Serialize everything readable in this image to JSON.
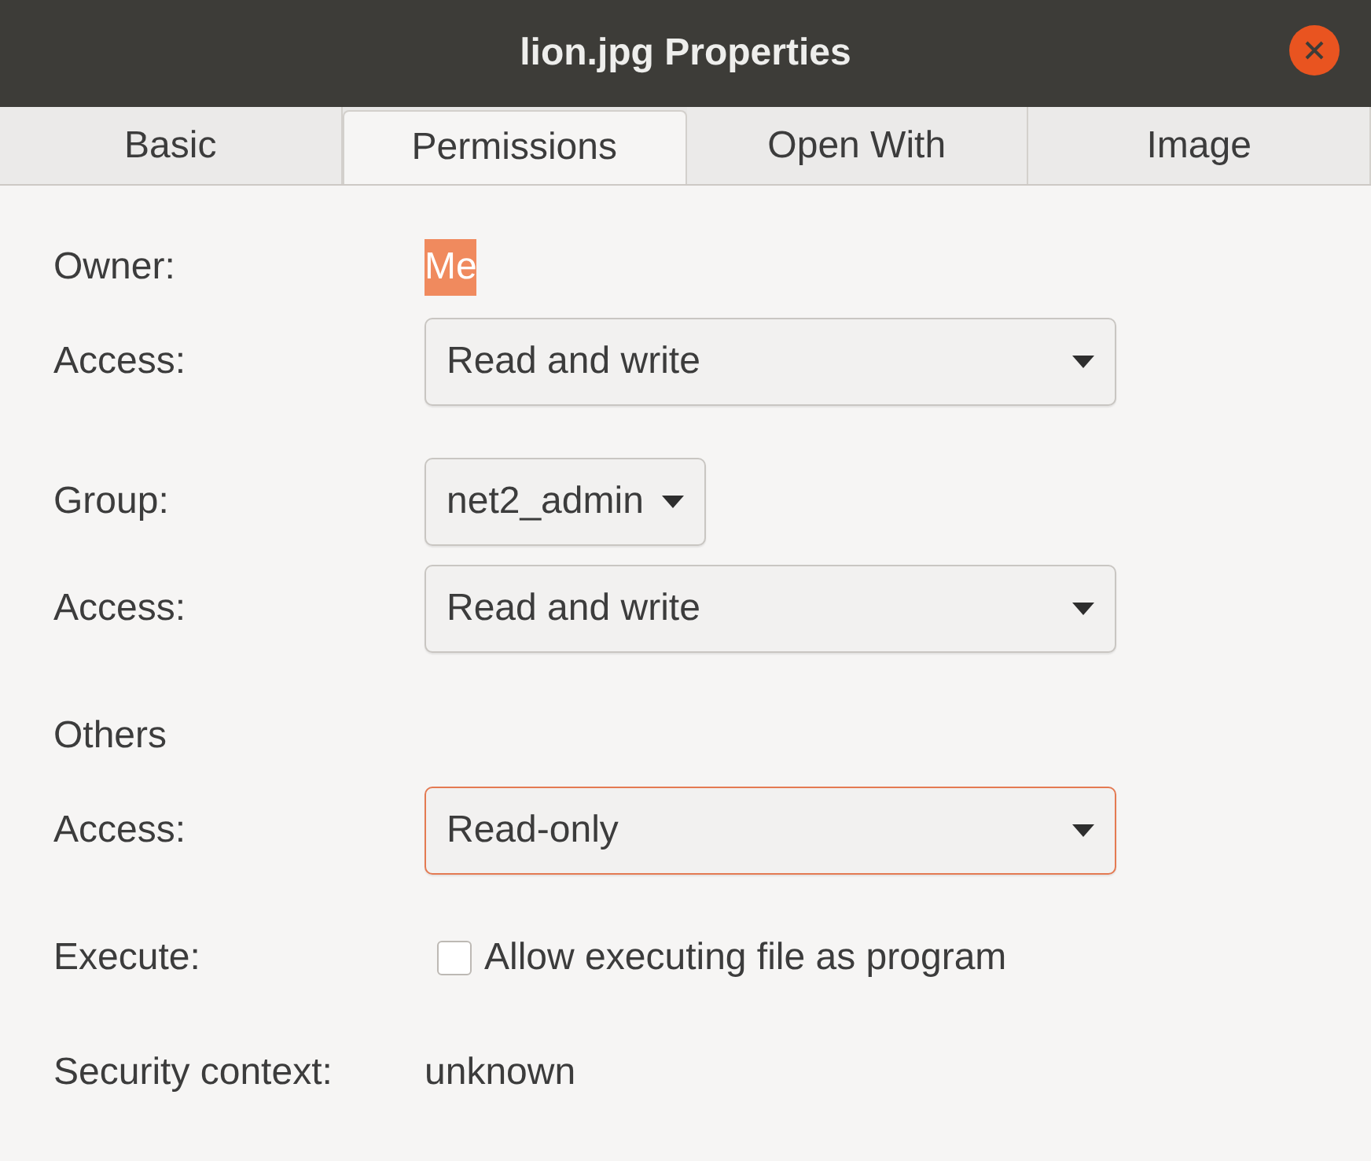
{
  "window": {
    "title": "lion.jpg Properties"
  },
  "tabs": [
    {
      "label": "Basic",
      "selected": false
    },
    {
      "label": "Permissions",
      "selected": true
    },
    {
      "label": "Open With",
      "selected": false
    },
    {
      "label": "Image",
      "selected": false
    }
  ],
  "sections": [
    {
      "rows": [
        {
          "kind": "value",
          "label": "Owner:",
          "value": "Me",
          "highlighted": true
        },
        {
          "kind": "dropdown",
          "label": "Access:",
          "value": "Read and write",
          "focused": false
        }
      ]
    },
    {
      "rows": [
        {
          "kind": "compact_dropdown",
          "label": "Group:",
          "value": "net2_admin",
          "focused": false
        },
        {
          "kind": "dropdown",
          "label": "Access:",
          "value": "Read and write",
          "focused": false
        }
      ]
    },
    {
      "rows": [
        {
          "kind": "heading",
          "label": "Others"
        },
        {
          "kind": "dropdown",
          "label": "Access:",
          "value": "Read-only",
          "focused": true
        }
      ]
    },
    {
      "rows": [
        {
          "kind": "checkbox",
          "label": "Execute:",
          "text": "Allow executing file as program",
          "checked": false
        }
      ]
    },
    {
      "rows": [
        {
          "kind": "value",
          "label": "Security context:",
          "value": "unknown",
          "highlighted": false
        }
      ]
    }
  ]
}
